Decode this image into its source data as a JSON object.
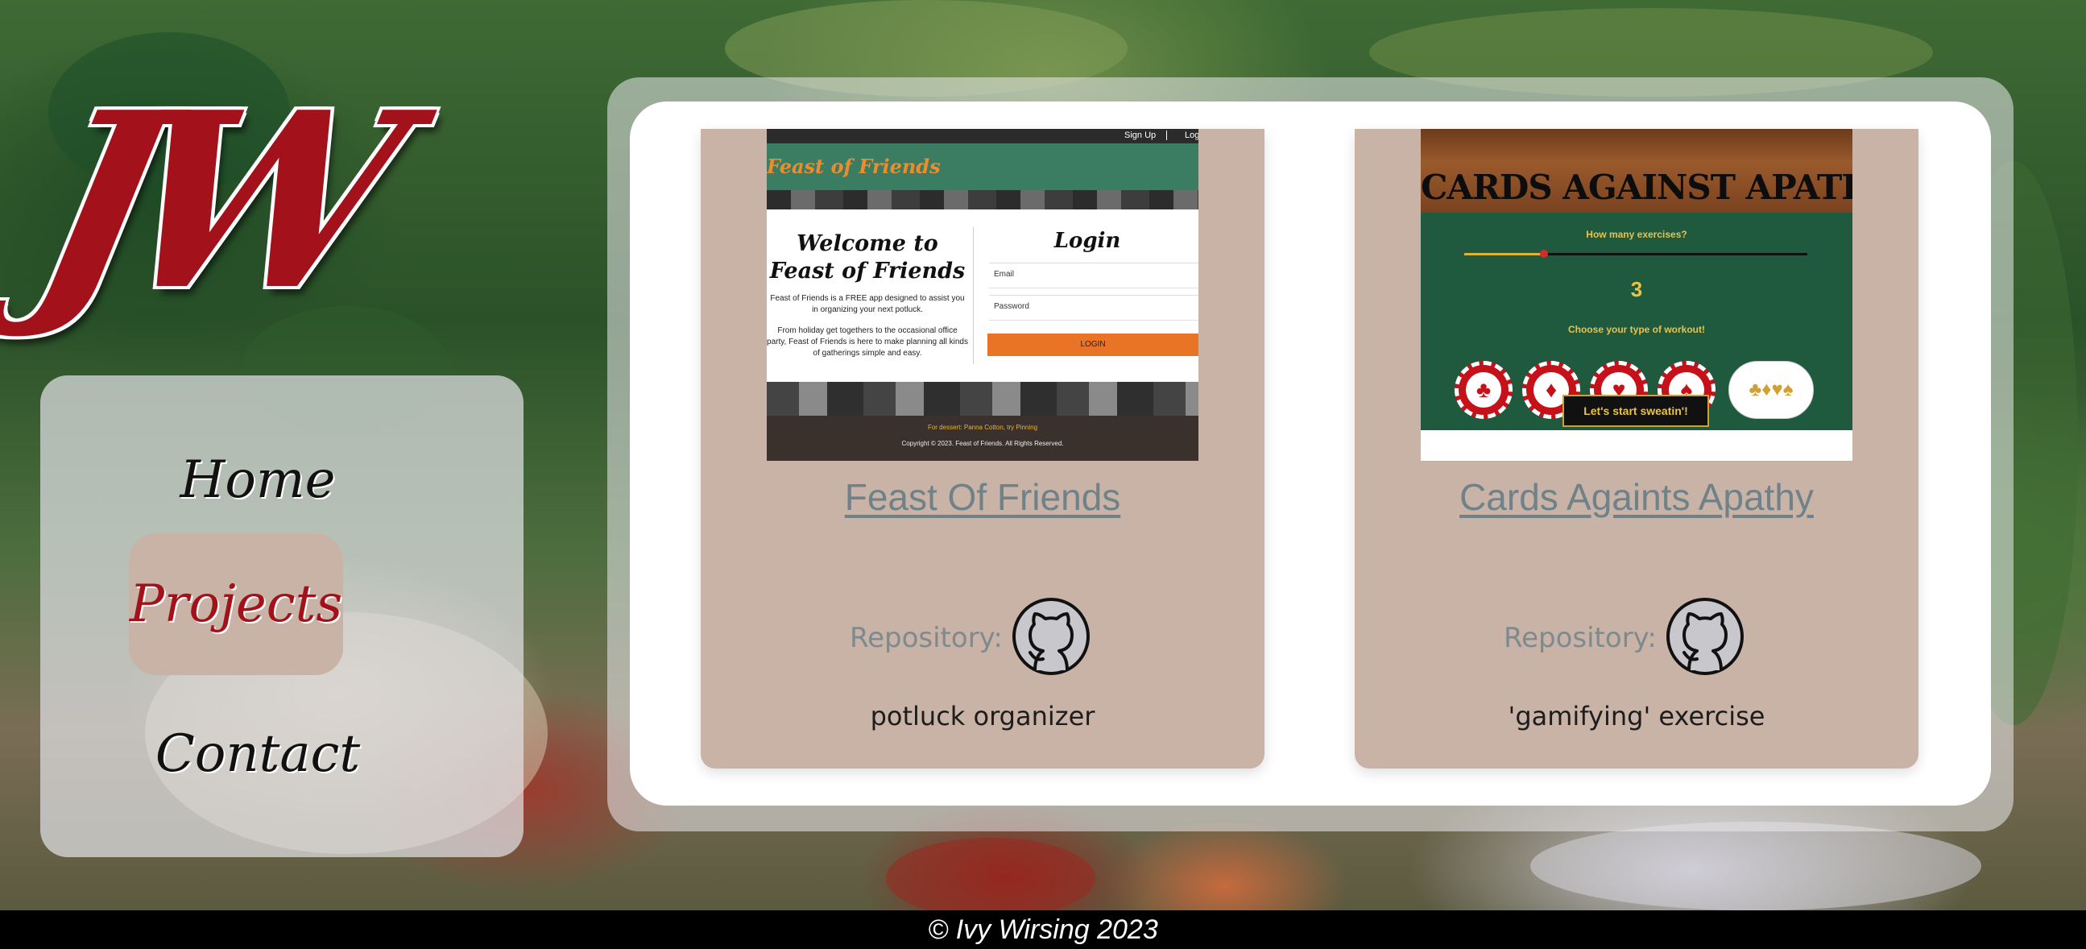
{
  "logo": {
    "text": "JW"
  },
  "nav": {
    "items": [
      {
        "label": "Home"
      },
      {
        "label": "Projects"
      },
      {
        "label": "Contact"
      }
    ],
    "active_color": "#a3121a"
  },
  "projects": [
    {
      "title": "Feast Of Friends",
      "repo_label": "Repository:",
      "repo_icon": "github-icon",
      "description": "potluck organizer",
      "screenshot": {
        "topbar_signup": "Sign Up",
        "topbar_login": "Log",
        "brand": "Feast of Friends",
        "welcome": "Welcome to Feast of Friends",
        "intro": "Feast of Friends is a FREE app designed to assist you in organizing your next potluck.",
        "intro2": "From holiday get togethers to the occasional office party, Feast of Friends is here to make planning all kinds of gatherings simple and easy.",
        "login_title": "Login",
        "email_label": "Email",
        "password_label": "Password",
        "login_button": "LOGIN",
        "footer_line1": "For dessert: Panna Cotton, try Pinning",
        "footer_line2": "Copyright © 2023. Feast of Friends. All Rights Reserved."
      }
    },
    {
      "title": "Cards Againts Apathy",
      "repo_label": "Repository:",
      "repo_icon": "github-icon",
      "description": "'gamifying' exercise",
      "screenshot": {
        "header": "CARDS AGAINST APATHY",
        "question1": "How many exercises?",
        "count": "3",
        "question2": "Choose your type of workout!",
        "chips": [
          "♣",
          "♦",
          "♥",
          "♠",
          "♣♦♥♠"
        ],
        "start_button": "Let's start sweatin'!"
      }
    }
  ],
  "footer": {
    "text": "© Ivy Wirsing 2023"
  },
  "colors": {
    "card_bg": "#c8b3a6",
    "title_link": "#6f8189",
    "footer_bg": "#000000"
  }
}
